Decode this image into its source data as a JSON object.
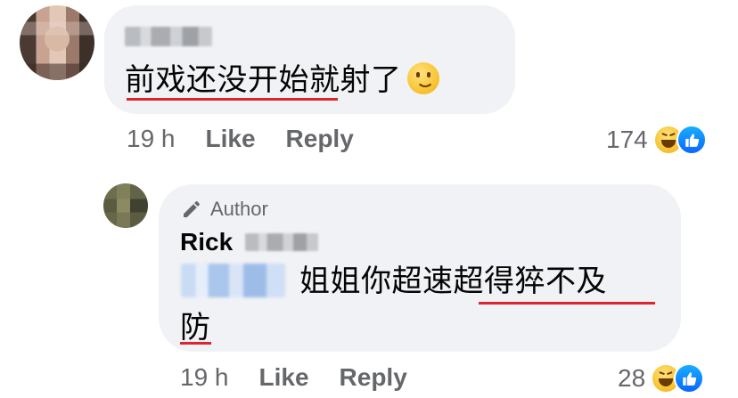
{
  "comment": {
    "text_underlined": "前戏还没开始",
    "text_rest": "就射了",
    "emoji_icon": "slightly-smiling-face-icon",
    "time": "19 h",
    "like_label": "Like",
    "reply_label": "Reply",
    "reaction_count": "174",
    "reaction_icons": [
      "haha-icon",
      "like-icon"
    ]
  },
  "reply": {
    "author_badge": "Author",
    "author_badge_icon": "pencil-icon",
    "name": "Rick",
    "text_line1_plain": "姐姐你超速",
    "text_line1_underlined": "超得猝不及",
    "text_line2": "防",
    "time": "19 h",
    "like_label": "Like",
    "reply_label": "Reply",
    "reaction_count": "28",
    "reaction_icons": [
      "haha-icon",
      "like-icon"
    ]
  },
  "colors": {
    "bubble": "#f0f2f5",
    "meta_text": "#65676b",
    "underline": "#e0242f",
    "like_blue": "#0866ff"
  }
}
